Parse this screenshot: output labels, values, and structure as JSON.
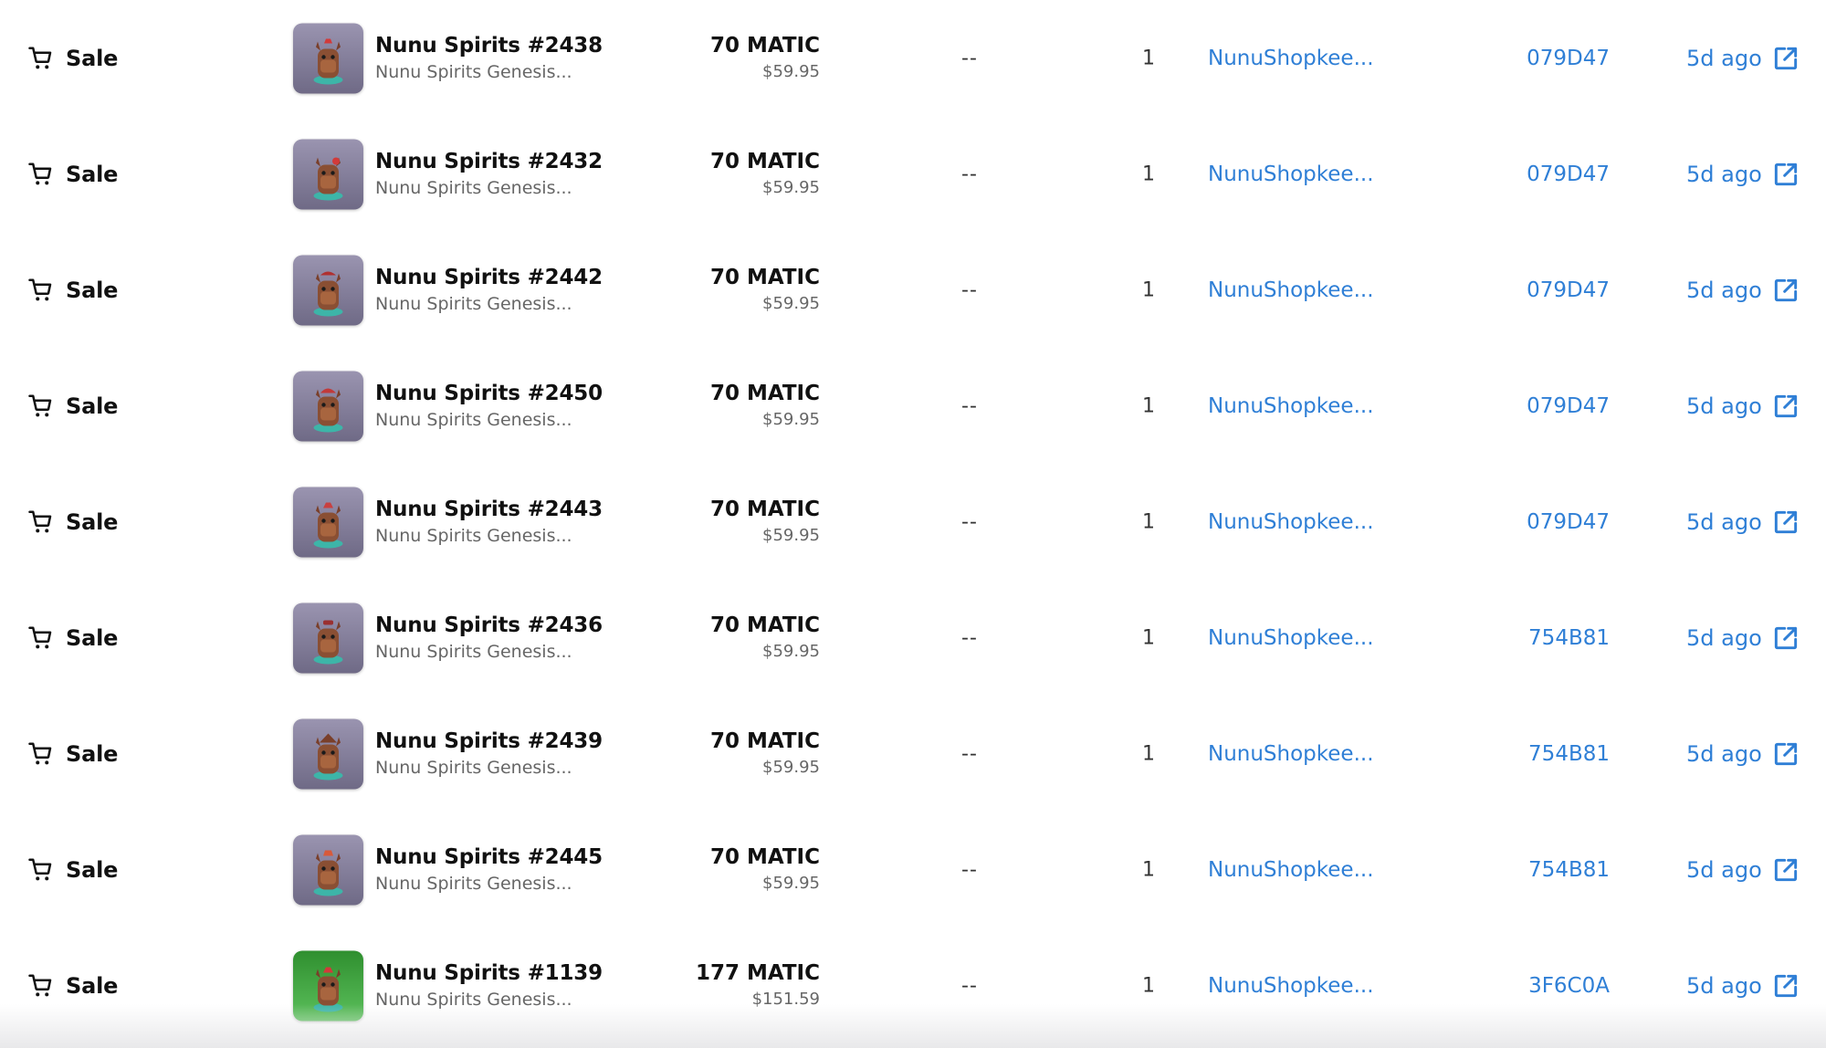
{
  "colors": {
    "link": "#2f7fd6",
    "muted": "#666666",
    "thumb_default_bg": "#8a84a2",
    "thumb_green_bg": "#4aa84a"
  },
  "icons": {
    "event": "shopping-cart-icon",
    "time": "external-link-icon"
  },
  "activity": {
    "rows": [
      {
        "event": "Sale",
        "name": "Nunu Spirits #2438",
        "collection": "Nunu Spirits Genesis...",
        "price": "70 MATIC",
        "usd": "$59.95",
        "rarity": "--",
        "qty": "1",
        "from": "NunuShopkee...",
        "to": "079D47",
        "time": "5d ago",
        "thumb": "purple"
      },
      {
        "event": "Sale",
        "name": "Nunu Spirits #2432",
        "collection": "Nunu Spirits Genesis...",
        "price": "70 MATIC",
        "usd": "$59.95",
        "rarity": "--",
        "qty": "1",
        "from": "NunuShopkee...",
        "to": "079D47",
        "time": "5d ago",
        "thumb": "purple"
      },
      {
        "event": "Sale",
        "name": "Nunu Spirits #2442",
        "collection": "Nunu Spirits Genesis...",
        "price": "70 MATIC",
        "usd": "$59.95",
        "rarity": "--",
        "qty": "1",
        "from": "NunuShopkee...",
        "to": "079D47",
        "time": "5d ago",
        "thumb": "purple"
      },
      {
        "event": "Sale",
        "name": "Nunu Spirits #2450",
        "collection": "Nunu Spirits Genesis...",
        "price": "70 MATIC",
        "usd": "$59.95",
        "rarity": "--",
        "qty": "1",
        "from": "NunuShopkee...",
        "to": "079D47",
        "time": "5d ago",
        "thumb": "purple"
      },
      {
        "event": "Sale",
        "name": "Nunu Spirits #2443",
        "collection": "Nunu Spirits Genesis...",
        "price": "70 MATIC",
        "usd": "$59.95",
        "rarity": "--",
        "qty": "1",
        "from": "NunuShopkee...",
        "to": "079D47",
        "time": "5d ago",
        "thumb": "purple"
      },
      {
        "event": "Sale",
        "name": "Nunu Spirits #2436",
        "collection": "Nunu Spirits Genesis...",
        "price": "70 MATIC",
        "usd": "$59.95",
        "rarity": "--",
        "qty": "1",
        "from": "NunuShopkee...",
        "to": "754B81",
        "time": "5d ago",
        "thumb": "purple"
      },
      {
        "event": "Sale",
        "name": "Nunu Spirits #2439",
        "collection": "Nunu Spirits Genesis...",
        "price": "70 MATIC",
        "usd": "$59.95",
        "rarity": "--",
        "qty": "1",
        "from": "NunuShopkee...",
        "to": "754B81",
        "time": "5d ago",
        "thumb": "purple"
      },
      {
        "event": "Sale",
        "name": "Nunu Spirits #2445",
        "collection": "Nunu Spirits Genesis...",
        "price": "70 MATIC",
        "usd": "$59.95",
        "rarity": "--",
        "qty": "1",
        "from": "NunuShopkee...",
        "to": "754B81",
        "time": "5d ago",
        "thumb": "purple"
      },
      {
        "event": "Sale",
        "name": "Nunu Spirits #1139",
        "collection": "Nunu Spirits Genesis...",
        "price": "177 MATIC",
        "usd": "$151.59",
        "rarity": "--",
        "qty": "1",
        "from": "NunuShopkee...",
        "to": "3F6C0A",
        "time": "5d ago",
        "thumb": "green"
      }
    ]
  }
}
